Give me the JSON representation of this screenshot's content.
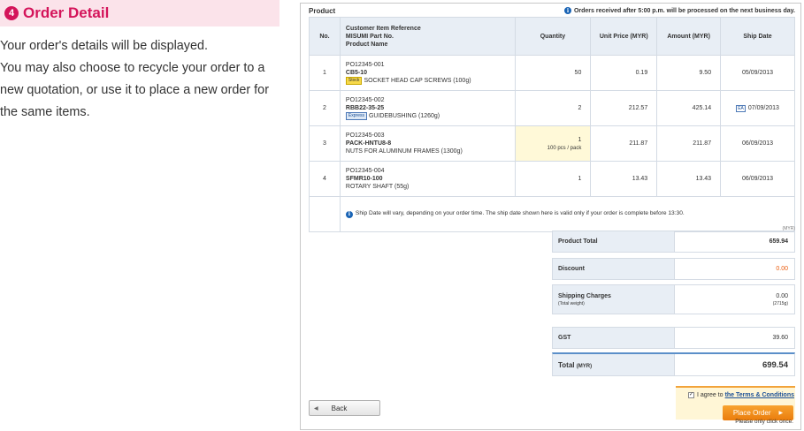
{
  "left": {
    "step_number": "4",
    "title": "Order Detail",
    "description": "Your order's details will be displayed.\nYou may also choose to recycle your order to a new quotation, or use it to place a new order for the same items."
  },
  "panel": {
    "product_label": "Product",
    "notice": "Orders received after 5:00 p.m. will be processed on the next business day.",
    "headers": {
      "no": "No.",
      "ref_line1": "Customer Item Reference",
      "ref_line2": "MISUMI Part No.",
      "ref_line3": "Product Name",
      "quantity": "Quantity",
      "unit_price": "Unit Price (MYR)",
      "amount": "Amount (MYR)",
      "ship_date": "Ship Date"
    },
    "rows": [
      {
        "no": "1",
        "ref": "PO12345-001",
        "part": "CB5-10",
        "badge": "Stock",
        "name": "SOCKET HEAD CAP SCREWS (100g)",
        "qty": "50",
        "pack": "",
        "unit_price": "0.19",
        "amount": "9.50",
        "ship_badge": "",
        "ship": "05/09/2013"
      },
      {
        "no": "2",
        "ref": "PO12345-002",
        "part": "RBB22-35-25",
        "badge": "Express",
        "name": "GUIDEBUSHING (1260g)",
        "qty": "2",
        "pack": "",
        "unit_price": "212.57",
        "amount": "425.14",
        "ship_badge": "EA",
        "ship": "07/09/2013"
      },
      {
        "no": "3",
        "ref": "PO12345-003",
        "part": "PACK-HNTU8-8",
        "badge": "",
        "name": "NUTS FOR ALUMINUM FRAMES (1300g)",
        "qty": "1",
        "pack": "100 pcs / pack",
        "unit_price": "211.87",
        "amount": "211.87",
        "ship_badge": "",
        "ship": "06/09/2013"
      },
      {
        "no": "4",
        "ref": "PO12345-004",
        "part": "SFMR10-100",
        "badge": "",
        "name": "ROTARY SHAFT (55g)",
        "qty": "1",
        "pack": "",
        "unit_price": "13.43",
        "amount": "13.43",
        "ship_badge": "",
        "ship": "06/09/2013"
      }
    ],
    "ship_note": "Ship Date will vary, depending on your order time. The ship date shown here is valid only if your order is complete before 13:30."
  },
  "summary": {
    "currency": "(MYR)",
    "product_total_label": "Product Total",
    "product_total": "659.94",
    "discount_label": "Discount",
    "discount": "0.00",
    "shipping_label": "Shipping Charges",
    "shipping_sub": "(Total weight)",
    "shipping": "0.00",
    "weight": "(2715g)",
    "gst_label": "GST",
    "gst": "39.60",
    "total_label": "Total",
    "total_currency": "(MYR)",
    "total": "699.54"
  },
  "actions": {
    "back_label": "Back",
    "agree_text": "I agree to",
    "terms_link": "the Terms & Conditions",
    "place_order_label": "Place Order",
    "click_once": "Please only click once."
  },
  "colors": {
    "accent": "#d4145a",
    "header_bg": "#e8eef5",
    "order_button": "#ea7c0c",
    "discount_text": "#ea5b0c"
  }
}
